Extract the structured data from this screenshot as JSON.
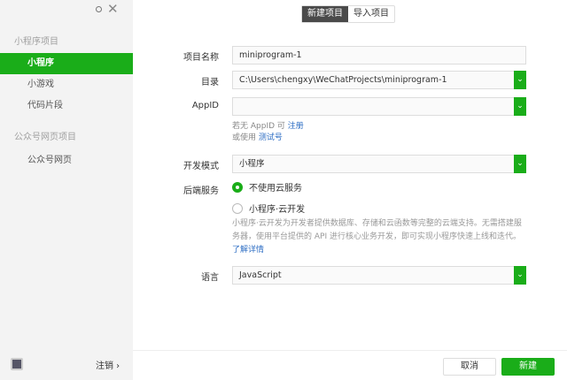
{
  "sidebar": {
    "section1_title": "小程序项目",
    "items1": [
      {
        "label": "小程序"
      },
      {
        "label": "小游戏"
      },
      {
        "label": "代码片段"
      }
    ],
    "section2_title": "公众号网页项目",
    "items2": [
      {
        "label": "公众号网页"
      }
    ],
    "logout_label": "注销 ›"
  },
  "tabs": {
    "new": "新建项目",
    "import": "导入项目"
  },
  "form": {
    "name_label": "项目名称",
    "name_value": "miniprogram-1",
    "dir_label": "目录",
    "dir_value": "C:\\Users\\chengxy\\WeChatProjects\\miniprogram-1",
    "appid_label": "AppID",
    "appid_value": "",
    "appid_hint_prefix": "若无 AppID 可",
    "appid_hint_register": "注册",
    "appid_hint_or": "或使用",
    "appid_hint_test": "测试号",
    "mode_label": "开发模式",
    "mode_value": "小程序",
    "backend_label": "后端服务",
    "backend_opt1": "不使用云服务",
    "backend_opt2": "小程序·云开发",
    "backend_desc": "小程序·云开发为开发者提供数据库、存储和云函数等完整的云端支持。无需搭建服务器，使用平台提供的 API 进行核心业务开发，即可实现小程序快速上线和迭代。",
    "backend_more": "了解详情",
    "lang_label": "语言",
    "lang_value": "JavaScript"
  },
  "footer": {
    "cancel": "取消",
    "create": "新建"
  },
  "colors": {
    "accent": "#1aad19",
    "link": "#2e6ec4"
  }
}
